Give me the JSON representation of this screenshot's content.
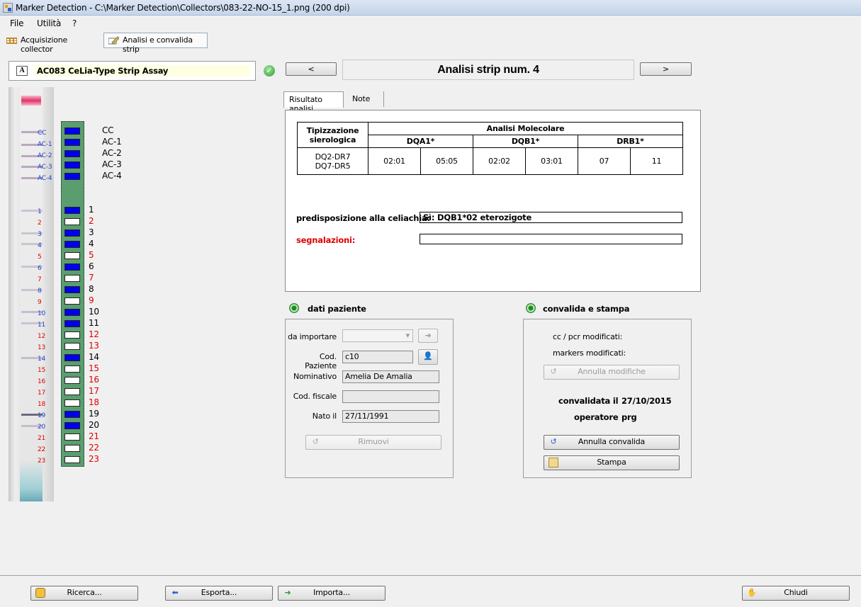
{
  "window": {
    "title": "Marker Detection - C:\\Marker Detection\\Collectors\\083-22-NO-15_1.png (200 dpi)"
  },
  "menu": {
    "file": "File",
    "utilita": "Utilità",
    "help": "?"
  },
  "toolbar": {
    "acquisizione": "Acquisizione collector",
    "analisi": "Analisi e convalida strip"
  },
  "assay": {
    "name": "AC083 CeLia-Type Strip Assay"
  },
  "nav": {
    "prev": "<",
    "next": ">",
    "title": "Analisi strip num. 4"
  },
  "strip_codes": [
    "CC",
    "AC-1",
    "AC-2",
    "AC-3",
    "AC-4",
    "1",
    "2",
    "3",
    "4",
    "5",
    "6",
    "7",
    "8",
    "9",
    "10",
    "11",
    "12",
    "13",
    "14",
    "15",
    "16",
    "17",
    "18",
    "19",
    "20",
    "21",
    "22",
    "23"
  ],
  "markers": {
    "controls": [
      {
        "label": "CC",
        "on": true
      },
      {
        "label": "AC-1",
        "on": true
      },
      {
        "label": "AC-2",
        "on": true
      },
      {
        "label": "AC-3",
        "on": true
      },
      {
        "label": "AC-4",
        "on": true
      }
    ],
    "probes": [
      {
        "label": "1",
        "on": true
      },
      {
        "label": "2",
        "on": false
      },
      {
        "label": "3",
        "on": true
      },
      {
        "label": "4",
        "on": true
      },
      {
        "label": "5",
        "on": false
      },
      {
        "label": "6",
        "on": true
      },
      {
        "label": "7",
        "on": false
      },
      {
        "label": "8",
        "on": true
      },
      {
        "label": "9",
        "on": false
      },
      {
        "label": "10",
        "on": true
      },
      {
        "label": "11",
        "on": true
      },
      {
        "label": "12",
        "on": false
      },
      {
        "label": "13",
        "on": false
      },
      {
        "label": "14",
        "on": true
      },
      {
        "label": "15",
        "on": false
      },
      {
        "label": "16",
        "on": false
      },
      {
        "label": "17",
        "on": false
      },
      {
        "label": "18",
        "on": false
      },
      {
        "label": "19",
        "on": true
      },
      {
        "label": "20",
        "on": true
      },
      {
        "label": "21",
        "on": false
      },
      {
        "label": "22",
        "on": false
      },
      {
        "label": "23",
        "on": false
      }
    ]
  },
  "tabs": {
    "risultato": "Risultato analisi",
    "note": "Note"
  },
  "result": {
    "tip_header": "Tipizzazione sierologica",
    "mol_header": "Analisi Molecolare",
    "dqa1": "DQA1*",
    "dqb1": "DQB1*",
    "drb1": "DRB1*",
    "tip_value_1": "DQ2-DR7",
    "tip_value_2": "DQ7-DR5",
    "dqa1_a": "02:01",
    "dqa1_b": "05:05",
    "dqb1_a": "02:02",
    "dqb1_b": "03:01",
    "drb1_a": "07",
    "drb1_b": "11",
    "predisp_label": "predisposizione alla celiachia:",
    "predisp_value": "Sì: DQB1*02 eterozigote",
    "segn_label": "segnalazioni:",
    "segn_value": ""
  },
  "patient": {
    "title": "dati paziente",
    "import_label": "da importare",
    "import_value": "",
    "code_label": "Cod. Paziente",
    "code_value": "c10",
    "name_label": "Nominativo",
    "name_value": "Amelia De Amalia",
    "fiscal_label": "Cod. fiscale",
    "fiscal_value": "",
    "birth_label": "Nato il",
    "birth_value": "27/11/1991",
    "remove": "Rimuovi"
  },
  "validation": {
    "title": "convalida e stampa",
    "cc_mod": "cc / pcr modificati:",
    "markers_mod": "markers modificati:",
    "undo_mod": "Annulla modifiche",
    "validated_label": "convalidata il",
    "validated_value": "27/10/2015",
    "operator_label": "operatore",
    "operator_value": "prg",
    "undo_validation": "Annulla convalida",
    "print": "Stampa"
  },
  "footer": {
    "search": "Ricerca...",
    "export": "Esporta...",
    "import": "Importa...",
    "close": "Chiudi"
  },
  "colors": {
    "marker_on": "#0000ee",
    "marker_off": "#ffffff",
    "strip_bg": "#5a9e6f",
    "assay_bg": "#ffffe1",
    "alert": "#e00000"
  }
}
